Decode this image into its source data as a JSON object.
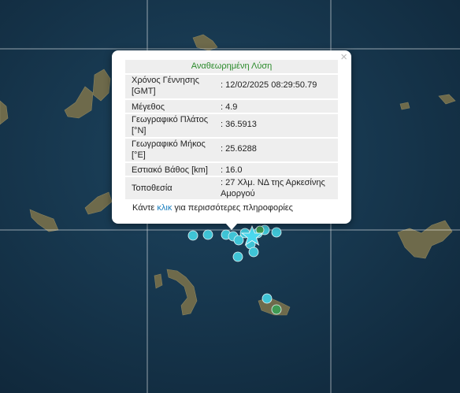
{
  "popup": {
    "title": "Αναθεωρημένη Λύση",
    "close_label": "×",
    "rows": [
      {
        "label": "Χρόνος Γέννησης [GMT]",
        "value": ": 12/02/2025 08:29:50.79"
      },
      {
        "label": "Μέγεθος",
        "value": ": 4.9"
      },
      {
        "label": "Γεωγραφικό Πλάτος [°N]",
        "value": ": 36.5913"
      },
      {
        "label": "Γεωγραφικό Μήκος [°E]",
        "value": ": 25.6288"
      },
      {
        "label": "Εστιακό Βάθος [km]",
        "value": ": 16.0"
      },
      {
        "label": "Τοποθεσία",
        "value": ": 27 Χλμ. ΝΔ της Αρκεσίνης Αμοργού"
      }
    ],
    "more_prefix": "Κάντε ",
    "more_link": "κλικ",
    "more_suffix": " για περισσότερες πληροφορίες"
  },
  "colors": {
    "sea": "#16344b",
    "land": "#6f6a4e",
    "quake_cyan": "#3fc4d6",
    "quake_green": "#3f9a54",
    "star": "#4ad8ee",
    "popup_title": "#2a8a2a",
    "link": "#1a7fbf"
  },
  "markers": {
    "icons": [
      "quake-marker-cyan",
      "quake-marker-green",
      "epicenter-star-icon"
    ]
  }
}
